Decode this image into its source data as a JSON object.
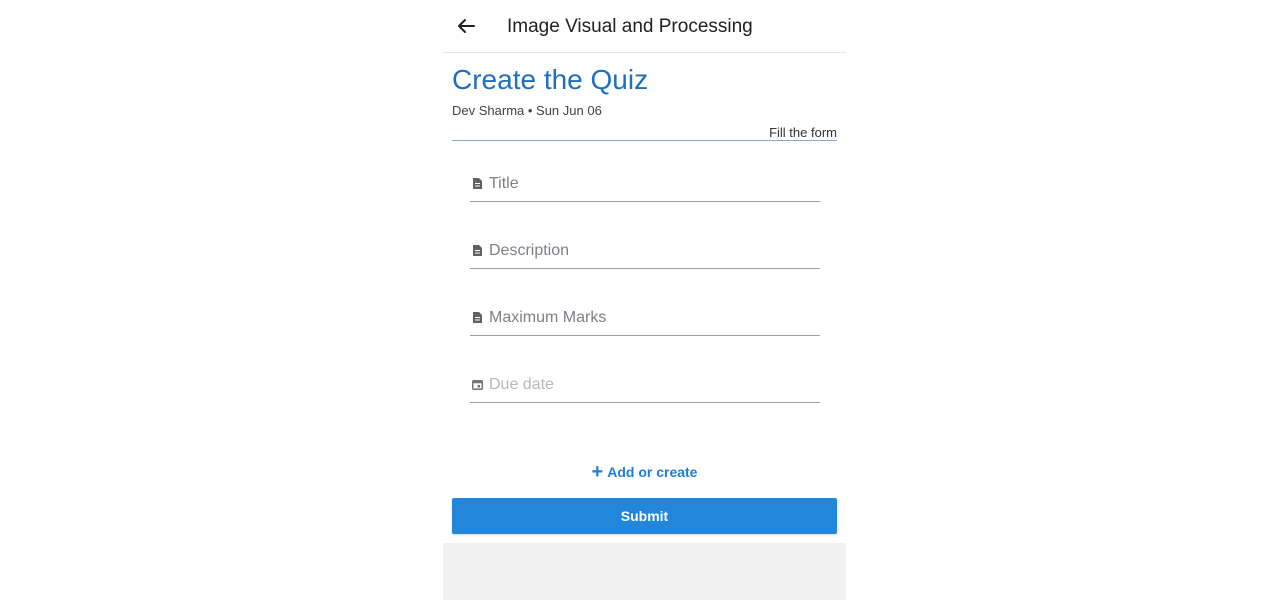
{
  "appbar": {
    "title": "Image Visual and Processing",
    "back_icon": "arrow-left-icon"
  },
  "page": {
    "title": "Create the Quiz",
    "meta": "Dev Sharma • Sun Jun 06",
    "form_hint": "Fill the form"
  },
  "form": {
    "title": {
      "placeholder": "Title",
      "value": "",
      "icon": "document-icon"
    },
    "description": {
      "placeholder": "Description",
      "value": "",
      "icon": "document-icon"
    },
    "max_marks": {
      "placeholder": "Maximum Marks",
      "value": "",
      "icon": "document-icon"
    },
    "due_date": {
      "placeholder": "Due date",
      "value": "",
      "icon": "calendar-icon"
    }
  },
  "actions": {
    "add_label": "Add or create",
    "add_icon": "plus-icon",
    "submit_label": "Submit"
  },
  "colors": {
    "accent": "#1f6fc1",
    "button": "#2287da",
    "link": "#1e7fd6"
  }
}
